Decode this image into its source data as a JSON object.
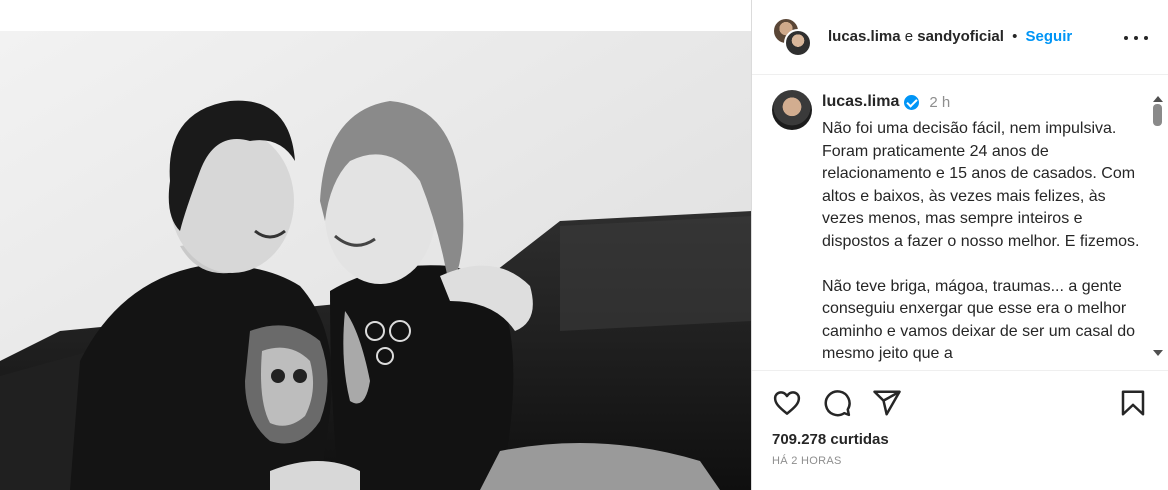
{
  "header": {
    "user1": "lucas.lima",
    "conjunction": "e",
    "user2": "sandyoficial",
    "separator": "•",
    "follow_label": "Seguir"
  },
  "caption": {
    "username": "lucas.lima",
    "time": "2 h",
    "paragraphs": [
      "Não foi uma decisão fácil, nem impulsiva. Foram praticamente 24 anos de relacionamento e 15 anos de casados. Com altos e baixos, às vezes mais felizes, às vezes menos, mas sempre inteiros e dispostos a fazer o nosso melhor. E fizemos.",
      "Não teve briga, mágoa, traumas... a gente conseguiu enxergar que esse era o melhor caminho e vamos deixar de ser um casal do mesmo jeito que a"
    ]
  },
  "actions": {
    "like_icon": "heart-icon",
    "comment_icon": "comment-icon",
    "share_icon": "share-icon",
    "save_icon": "bookmark-icon"
  },
  "stats": {
    "likes": "709.278 curtidas",
    "posted": "HÁ 2 HORAS"
  },
  "colors": {
    "accent": "#0095f6",
    "text": "#262626",
    "muted": "#8e8e8e"
  }
}
